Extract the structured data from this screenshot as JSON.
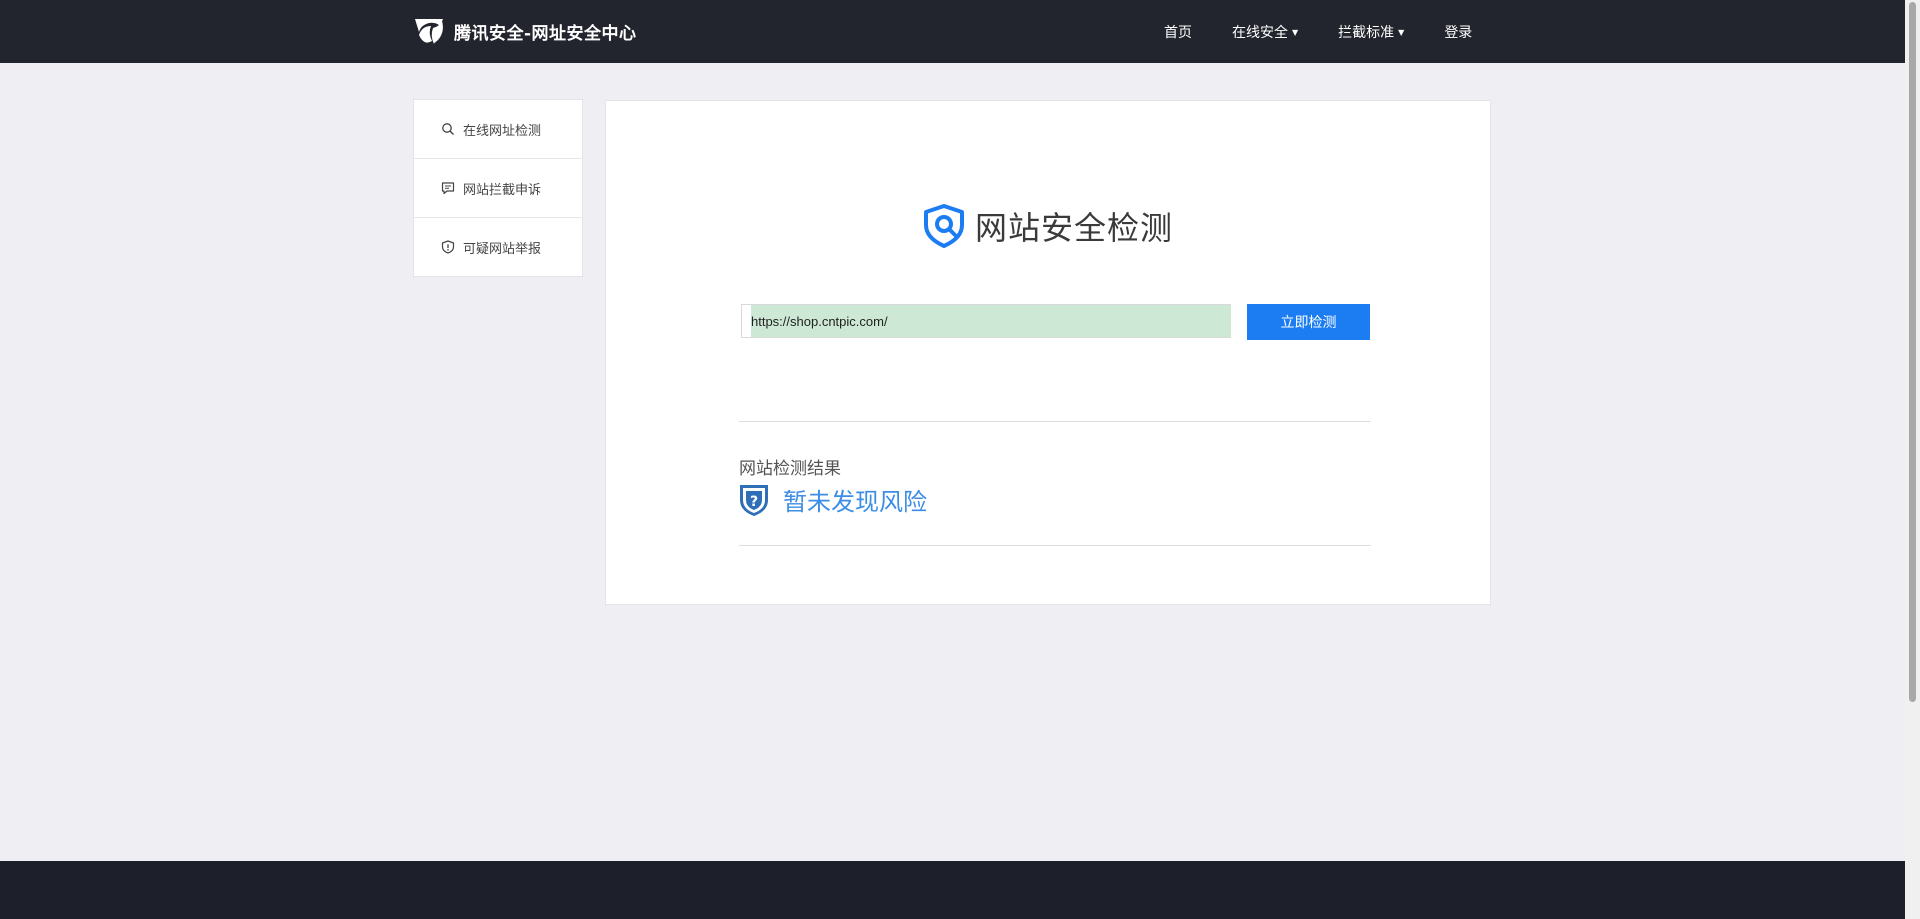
{
  "header": {
    "brand": "腾讯安全-网址安全中心",
    "nav": {
      "home": "首页",
      "online_security": "在线安全",
      "block_standard": "拦截标准",
      "login": "登录"
    }
  },
  "sidebar": {
    "items": [
      {
        "label": "在线网址检测",
        "icon": "search-icon"
      },
      {
        "label": "网站拦截申诉",
        "icon": "message-icon"
      },
      {
        "label": "可疑网站举报",
        "icon": "shield-alert-icon"
      }
    ]
  },
  "main": {
    "title": "网站安全检测",
    "url_input": {
      "value": "https://shop.cntpic.com/"
    },
    "check_button": "立即检测",
    "result_label": "网站检测结果",
    "result_status": "暂未发现风险"
  },
  "colors": {
    "accent": "#1c7df3",
    "result_text": "#3c8de6",
    "header_bg": "#22252d",
    "page_bg": "#eeeef3",
    "footer_bg": "#1d1f2a",
    "input_highlight": "#cde9d5"
  }
}
